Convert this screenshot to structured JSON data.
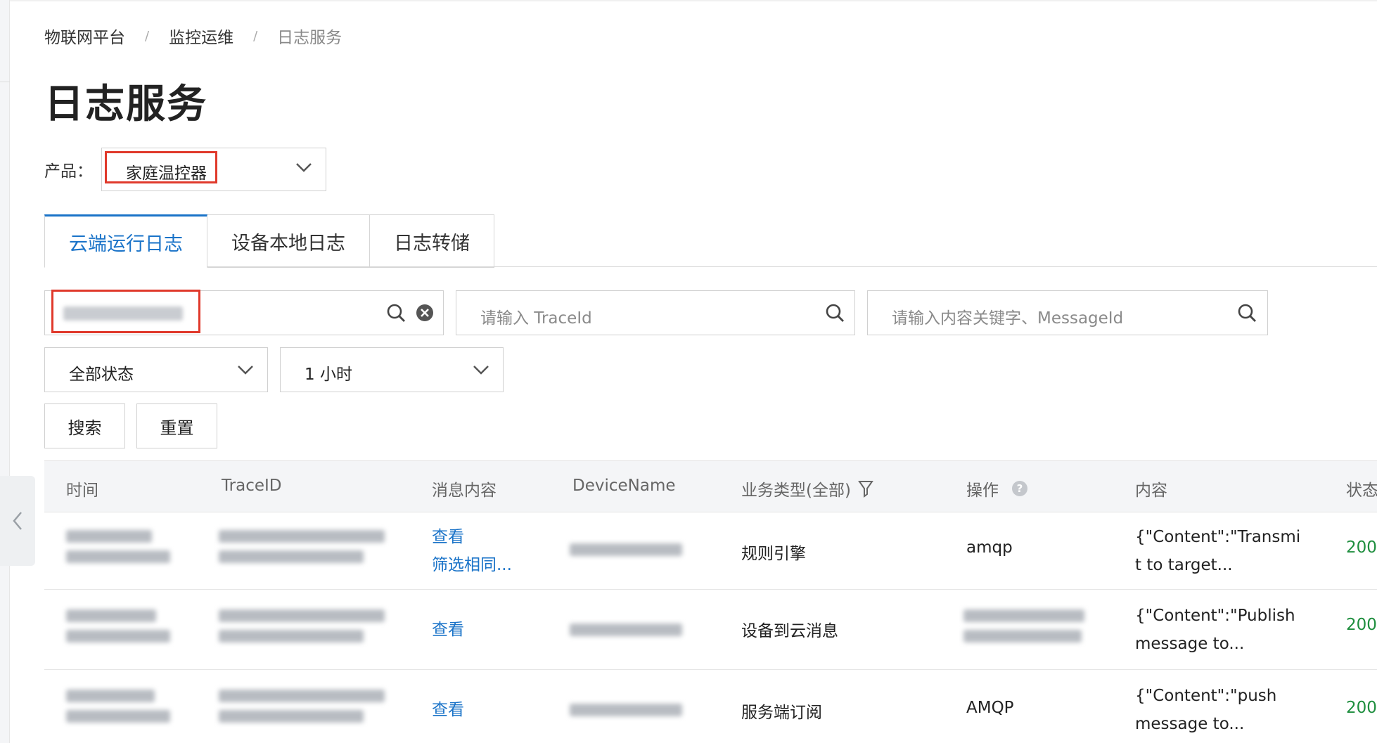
{
  "breadcrumb": [
    "物联网平台",
    "监控运维",
    "日志服务"
  ],
  "breadcrumb_separator": "/",
  "page_title": "日志服务",
  "product": {
    "label": "产品：",
    "selected": "家庭温控器"
  },
  "tabs": [
    {
      "label": "云端运行日志",
      "active": true
    },
    {
      "label": "设备本地日志",
      "active": false
    },
    {
      "label": "日志转储",
      "active": false
    }
  ],
  "filters": {
    "device_search_value": "",
    "traceid_placeholder": "请输入 TraceId",
    "keyword_placeholder": "请输入内容关键字、MessageId",
    "status_select": "全部状态",
    "time_select": "1 小时",
    "search_button": "搜索",
    "reset_button": "重置"
  },
  "table": {
    "headers": {
      "time": "时间",
      "traceid": "TraceID",
      "message": "消息内容",
      "device_name": "DeviceName",
      "biz_type": "业务类型(全部)",
      "operation": "操作",
      "content": "内容",
      "status": "状态"
    },
    "rows": [
      {
        "message_links": [
          "查看",
          "筛选相同..."
        ],
        "biz_type": "规则引擎",
        "operation": "amqp",
        "content": [
          "{\"Content\":\"Transmi",
          "t to target..."
        ],
        "status": "200"
      },
      {
        "message_links": [
          "查看"
        ],
        "biz_type": "设备到云消息",
        "operation": "",
        "content": [
          "{\"Content\":\"Publish",
          "message to..."
        ],
        "status": "200"
      },
      {
        "message_links": [
          "查看"
        ],
        "biz_type": "服务端订阅",
        "operation": "AMQP",
        "content": [
          "{\"Content\":\"push",
          "message to..."
        ],
        "status": "200"
      }
    ]
  },
  "colors": {
    "accent": "#1a73c8",
    "status_ok": "#1e8e3e",
    "highlight": "#e0392b"
  }
}
